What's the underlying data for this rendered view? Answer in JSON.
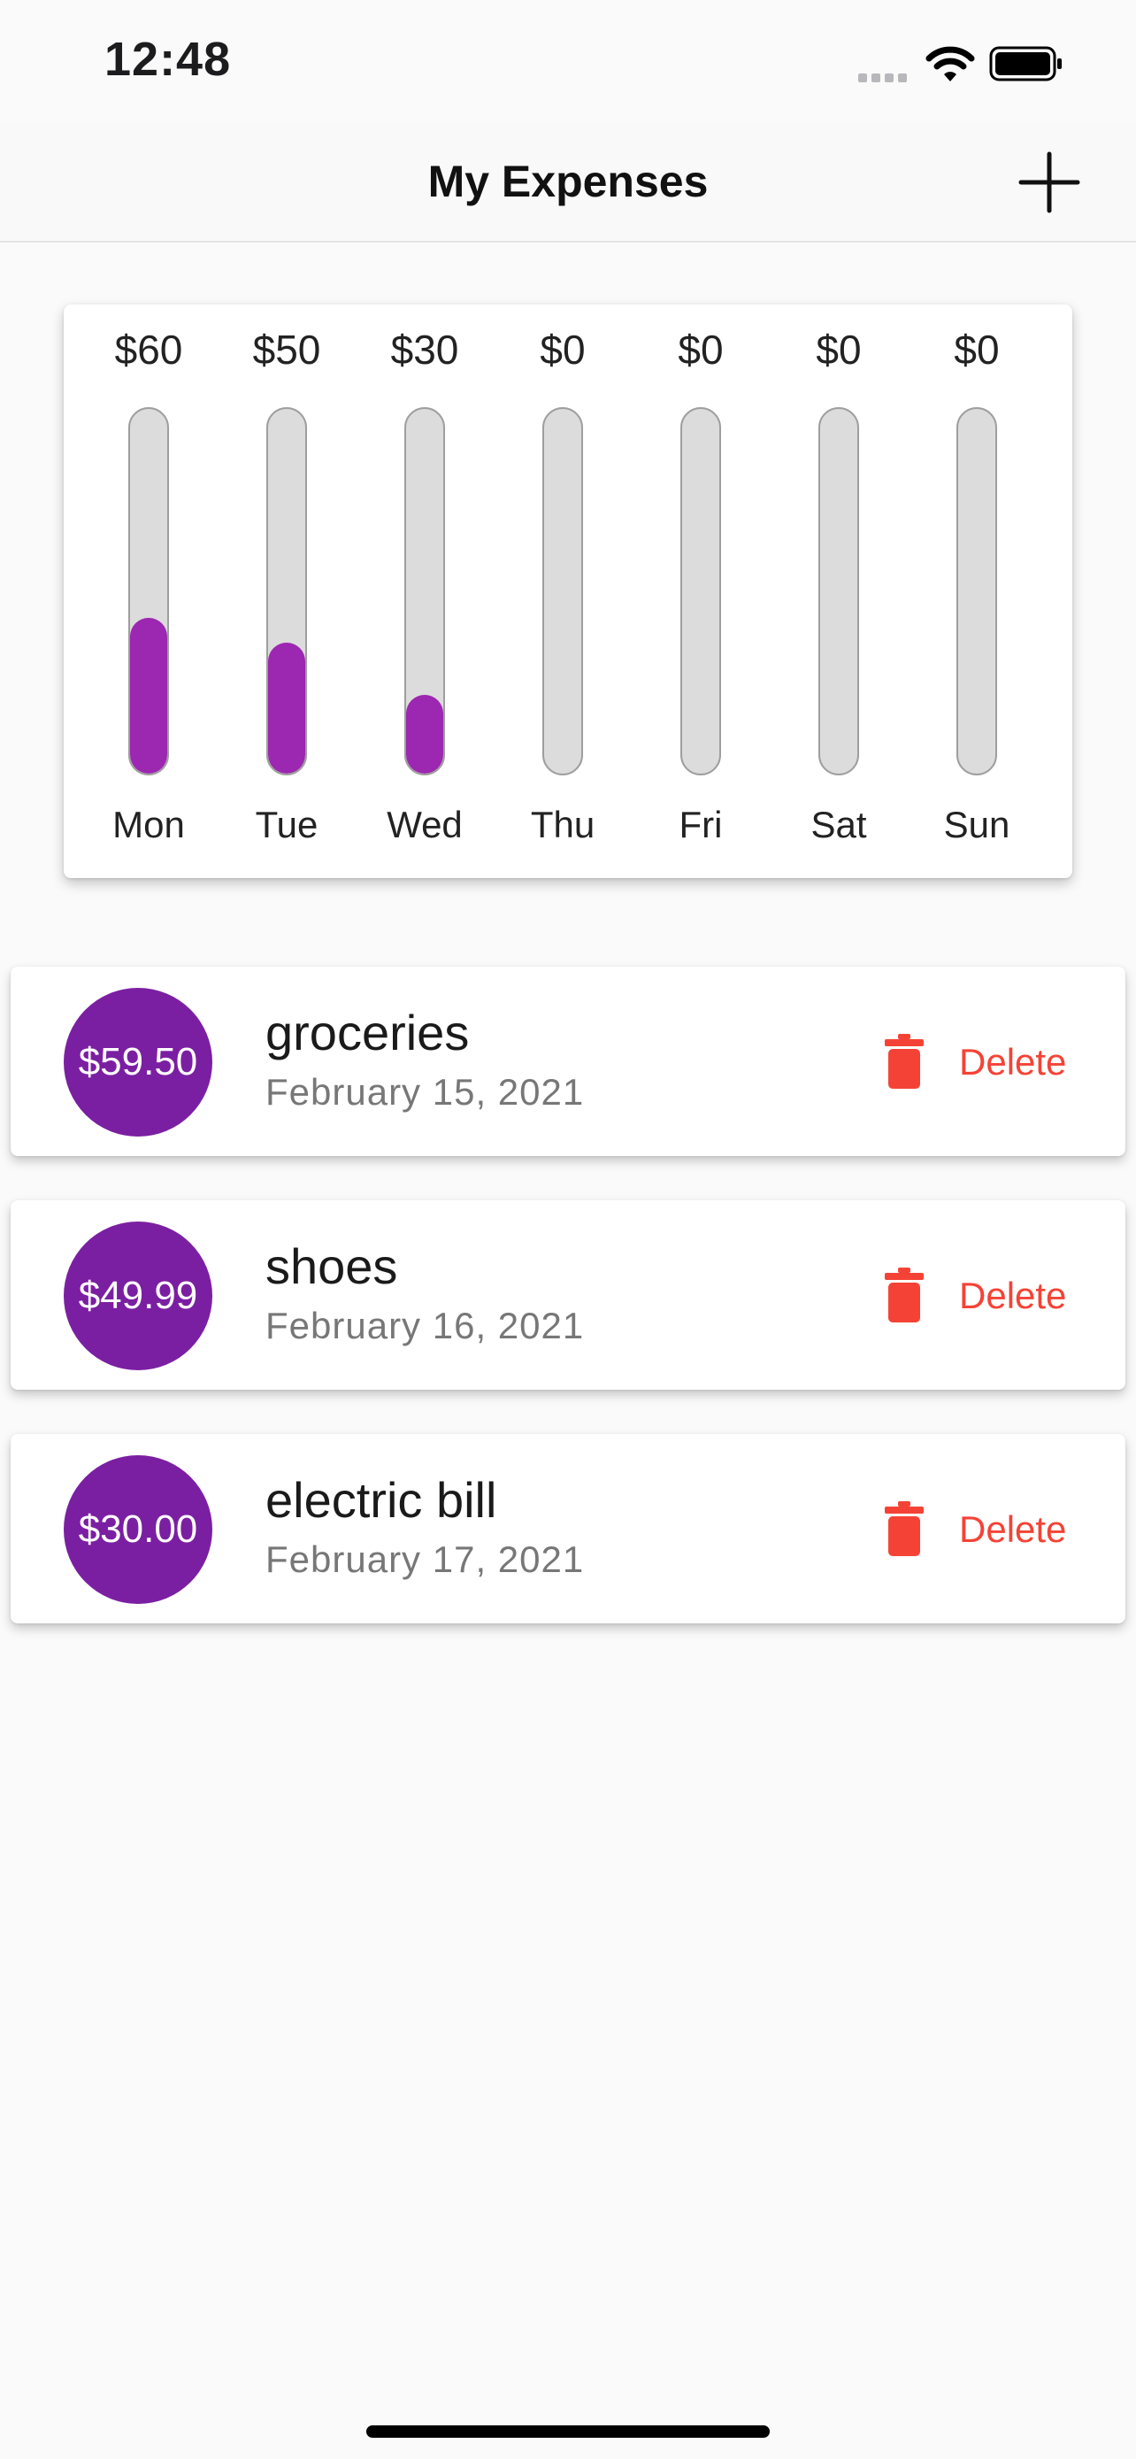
{
  "status_bar": {
    "time": "12:48"
  },
  "app_bar": {
    "title": "My Expenses"
  },
  "colors": {
    "accent": "#9c27b0",
    "avatar": "#7b1fa2",
    "danger": "#f44336",
    "track": "#dcdcdc"
  },
  "chart_data": {
    "type": "bar",
    "categories": [
      "Mon",
      "Tue",
      "Wed",
      "Thu",
      "Fri",
      "Sat",
      "Sun"
    ],
    "labels": [
      "$60",
      "$50",
      "$30",
      "$0",
      "$0",
      "$0",
      "$0"
    ],
    "values": [
      59.5,
      49.99,
      30.0,
      0,
      0,
      0,
      0
    ],
    "ylim": [
      0,
      139.49
    ]
  },
  "transactions": [
    {
      "amount": "$59.50",
      "title": "groceries",
      "date": "February 15, 2021",
      "delete_label": "Delete"
    },
    {
      "amount": "$49.99",
      "title": "shoes",
      "date": "February 16, 2021",
      "delete_label": "Delete"
    },
    {
      "amount": "$30.00",
      "title": "electric bill",
      "date": "February 17, 2021",
      "delete_label": "Delete"
    }
  ]
}
